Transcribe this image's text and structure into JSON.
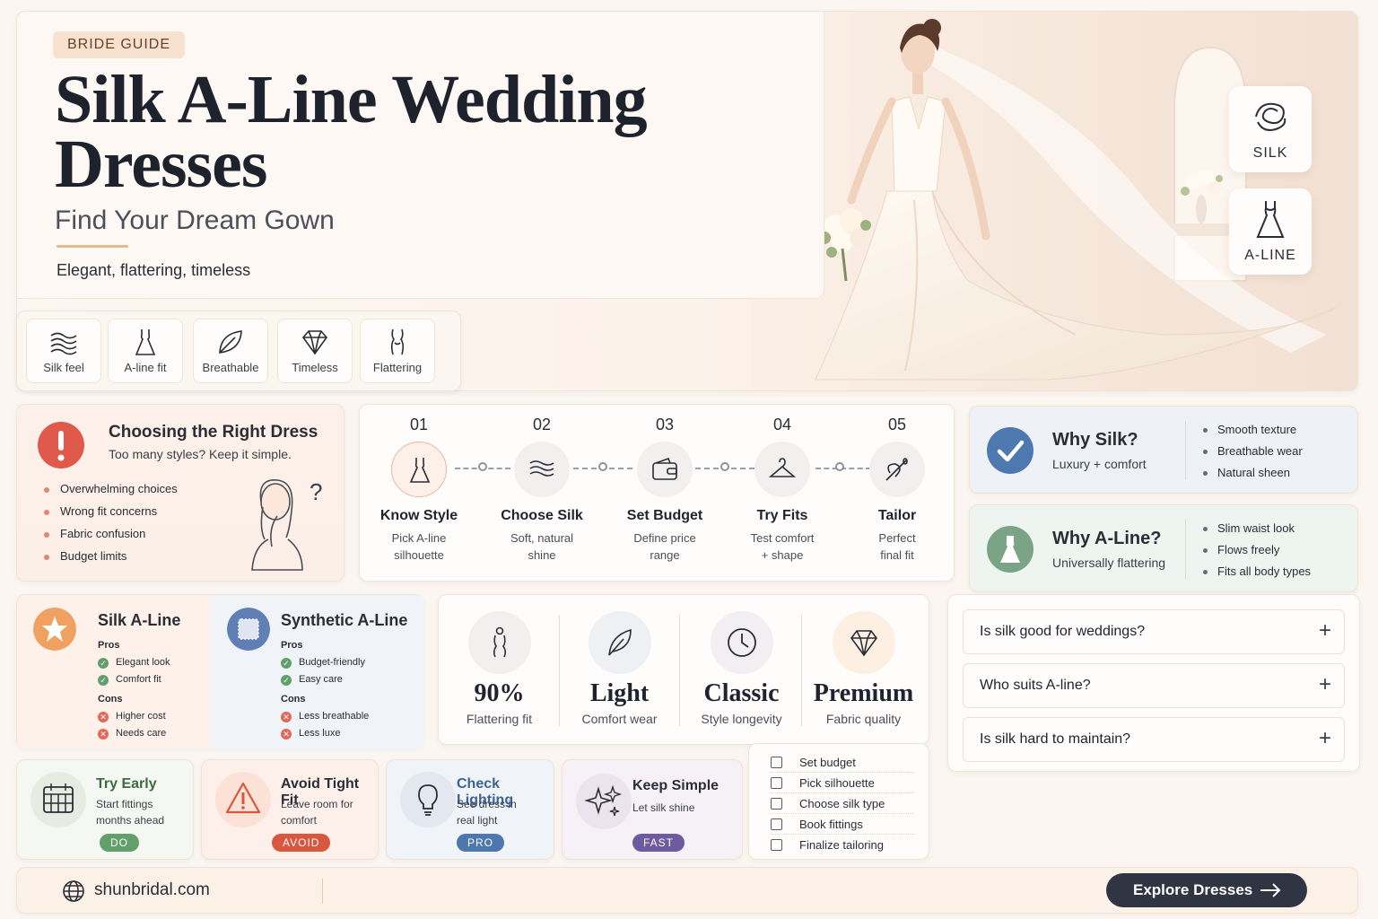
{
  "hero": {
    "badge": "BRIDE GUIDE",
    "title": "Silk A-Line Wedding Dresses",
    "subtitle": "Find Your Dream Gown",
    "tagline": "Elegant, flattering, timeless",
    "side_badges": [
      {
        "label": "SILK",
        "icon": "silk-knot-icon"
      },
      {
        "label": "A-LINE",
        "icon": "a-line-dress-icon"
      }
    ]
  },
  "features": [
    {
      "label": "Silk feel",
      "icon": "waves-icon"
    },
    {
      "label": "A-line fit",
      "icon": "dress-icon"
    },
    {
      "label": "Breathable",
      "icon": "leaf-icon"
    },
    {
      "label": "Timeless",
      "icon": "diamond-icon"
    },
    {
      "label": "Flattering",
      "icon": "body-icon"
    }
  ],
  "choosing": {
    "title": "Choosing the Right Dress",
    "subtitle": "Too many styles? Keep it simple.",
    "items": [
      "Overwhelming choices",
      "Wrong fit concerns",
      "Fabric confusion",
      "Budget limits"
    ],
    "question_mark": "?"
  },
  "steps": [
    {
      "num": "01",
      "title": "Know Style",
      "desc1": "Pick A-line",
      "desc2": "silhouette",
      "icon": "dress-icon"
    },
    {
      "num": "02",
      "title": "Choose Silk",
      "desc1": "Soft, natural",
      "desc2": "shine",
      "icon": "waves-icon"
    },
    {
      "num": "03",
      "title": "Set Budget",
      "desc1": "Define price",
      "desc2": "range",
      "icon": "wallet-icon"
    },
    {
      "num": "04",
      "title": "Try Fits",
      "desc1": "Test comfort",
      "desc2": "+ shape",
      "icon": "hanger-icon"
    },
    {
      "num": "05",
      "title": "Tailor",
      "desc1": "Perfect",
      "desc2": "final fit",
      "icon": "needle-icon"
    }
  ],
  "why": {
    "silk": {
      "title": "Why Silk?",
      "subtitle": "Luxury + comfort",
      "points": [
        "Smooth texture",
        "Breathable wear",
        "Natural sheen"
      ]
    },
    "aline": {
      "title": "Why A-Line?",
      "subtitle": "Universally flattering",
      "points": [
        "Slim waist look",
        "Flows freely",
        "Fits all body types"
      ]
    }
  },
  "compare": {
    "silk": {
      "title": "Silk A-Line",
      "pros_label": "Pros",
      "pros": [
        "Elegant look",
        "Comfort fit"
      ],
      "cons_label": "Cons",
      "cons": [
        "Higher cost",
        "Needs care"
      ]
    },
    "synthetic": {
      "title": "Synthetic A-Line",
      "pros_label": "Pros",
      "pros": [
        "Budget-friendly",
        "Easy care"
      ],
      "cons_label": "Cons",
      "cons": [
        "Less breathable",
        "Less luxe"
      ]
    }
  },
  "stats": [
    {
      "value": "90%",
      "label": "Flattering fit",
      "icon": "body-icon"
    },
    {
      "value": "Light",
      "label": "Comfort wear",
      "icon": "feather-icon"
    },
    {
      "value": "Classic",
      "label": "Style longevity",
      "icon": "clock-icon"
    },
    {
      "value": "Premium",
      "label": "Fabric quality",
      "icon": "diamond-icon"
    }
  ],
  "faq": [
    {
      "q": "Is silk good for weddings?",
      "plus": "+"
    },
    {
      "q": "Who suits A-line?",
      "plus": "+"
    },
    {
      "q": "Is silk hard to maintain?",
      "plus": "+"
    }
  ],
  "tips": [
    {
      "title": "Try Early",
      "desc1": "Start fittings",
      "desc2": "months ahead",
      "pill": "DO",
      "icon": "calendar-icon"
    },
    {
      "title": "Avoid Tight Fit",
      "desc1": "Leave room for",
      "desc2": "comfort",
      "pill": "AVOID",
      "icon": "warning-icon"
    },
    {
      "title": "Check Lighting",
      "desc1": "See dress in",
      "desc2": "real light",
      "pill": "PRO",
      "icon": "lightbulb-icon"
    },
    {
      "title": "Keep Simple",
      "desc1": "Let silk shine",
      "desc2": "",
      "pill": "FAST",
      "icon": "sparkles-icon"
    }
  ],
  "checklist": [
    "Set budget",
    "Pick silhouette",
    "Choose silk type",
    "Book fittings",
    "Finalize tailoring"
  ],
  "footer": {
    "url": "shunbridal.com",
    "cta": "Explore Dresses"
  },
  "colors": {
    "accent_peach": "#e6b98e",
    "alert_red": "#e05a4c",
    "check_blue": "#4d78b0",
    "aline_green": "#7aa483",
    "star_orange": "#f0a060",
    "pill_do": "#62a06b",
    "pill_avoid": "#d9573f",
    "pill_pro": "#4c78ad",
    "pill_fast": "#6e5a9e",
    "button_dark": "#2f3542"
  }
}
